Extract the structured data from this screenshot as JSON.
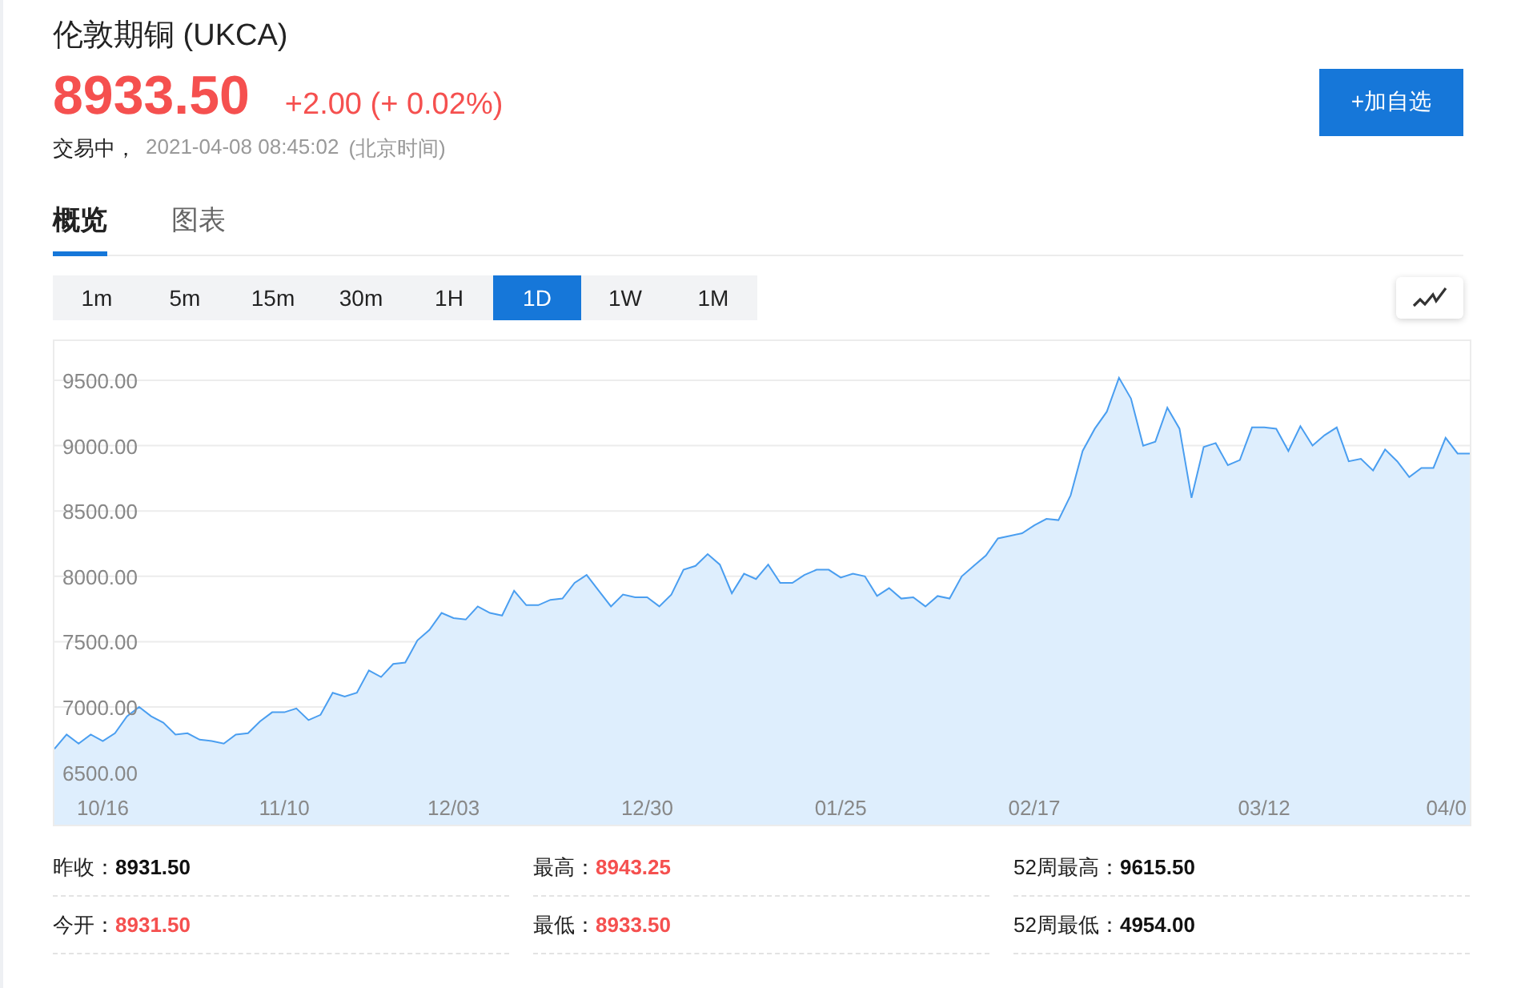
{
  "header": {
    "title": "伦敦期铜 (UKCA)",
    "price": "8933.50",
    "change": "+2.00 (+ 0.02%)",
    "status": "交易中，",
    "timestamp": "2021-04-08 08:45:02",
    "timezone": "(北京时间)",
    "watch_button": "+加自选"
  },
  "tabs": [
    {
      "label": "概览",
      "selected": true
    },
    {
      "label": "图表",
      "selected": false
    }
  ],
  "periods": [
    {
      "label": "1m",
      "selected": false
    },
    {
      "label": "5m",
      "selected": false
    },
    {
      "label": "15m",
      "selected": false
    },
    {
      "label": "30m",
      "selected": false
    },
    {
      "label": "1H",
      "selected": false
    },
    {
      "label": "1D",
      "selected": true
    },
    {
      "label": "1W",
      "selected": false
    },
    {
      "label": "1M",
      "selected": false
    }
  ],
  "chart": {
    "chart_data": {
      "type": "area",
      "ylim": [
        6100,
        9800
      ],
      "grid": true,
      "categories": [
        null,
        null,
        null,
        null,
        "10/16",
        null,
        null,
        null,
        null,
        null,
        null,
        null,
        null,
        null,
        null,
        null,
        null,
        null,
        null,
        "11/10",
        null,
        null,
        null,
        null,
        null,
        null,
        null,
        null,
        null,
        null,
        null,
        null,
        null,
        "12/03",
        null,
        null,
        null,
        null,
        null,
        null,
        null,
        null,
        null,
        null,
        null,
        null,
        null,
        null,
        null,
        "12/30",
        null,
        null,
        null,
        null,
        null,
        null,
        null,
        null,
        null,
        null,
        null,
        null,
        null,
        null,
        null,
        "01/25",
        null,
        null,
        null,
        null,
        null,
        null,
        null,
        null,
        null,
        null,
        null,
        null,
        null,
        null,
        null,
        "02/17",
        null,
        null,
        null,
        null,
        null,
        null,
        null,
        null,
        null,
        null,
        null,
        null,
        null,
        null,
        null,
        null,
        null,
        null,
        "03/12",
        null,
        null,
        null,
        null,
        null,
        null,
        null,
        null,
        null,
        null,
        null,
        null,
        null,
        null,
        null,
        "04/0",
        null
      ],
      "yticks": [
        {
          "value": 6500,
          "label": "6500.00"
        },
        {
          "value": 7000,
          "label": "7000.00"
        },
        {
          "value": 7500,
          "label": "7500.00"
        },
        {
          "value": 8000,
          "label": "8000.00"
        },
        {
          "value": 8500,
          "label": "8500.00"
        },
        {
          "value": 9000,
          "label": "9000.00"
        },
        {
          "value": 9500,
          "label": "9500.00"
        }
      ],
      "series": [
        {
          "color": "#4a9ef0",
          "values": [
            6680,
            6790,
            6720,
            6790,
            6740,
            6800,
            6930,
            7000,
            6930,
            6880,
            6790,
            6800,
            6750,
            6740,
            6720,
            6790,
            6800,
            6890,
            6960,
            6960,
            6990,
            6900,
            6940,
            7110,
            7080,
            7110,
            7280,
            7230,
            7330,
            7340,
            7510,
            7590,
            7720,
            7680,
            7670,
            7770,
            7720,
            7700,
            7890,
            7780,
            7780,
            7820,
            7830,
            7950,
            8010,
            7890,
            7770,
            7860,
            7840,
            7840,
            7770,
            7860,
            8050,
            8080,
            8170,
            8090,
            7870,
            8020,
            7980,
            8090,
            7950,
            7950,
            8010,
            8050,
            8050,
            7990,
            8020,
            8000,
            7850,
            7910,
            7830,
            7840,
            7770,
            7850,
            7830,
            8000,
            8080,
            8160,
            8290,
            8310,
            8330,
            8390,
            8440,
            8430,
            8620,
            8960,
            9130,
            9260,
            9520,
            9360,
            9000,
            9030,
            9290,
            9130,
            8600,
            8990,
            9020,
            8850,
            8890,
            9140,
            9140,
            9130,
            8960,
            9150,
            9000,
            9080,
            9140,
            8880,
            8900,
            8810,
            8970,
            8880,
            8760,
            8830,
            8830,
            9060,
            8940,
            8940
          ]
        }
      ]
    }
  },
  "stats": [
    [
      {
        "label": "昨收：",
        "value": "8931.50",
        "color": "#111111"
      },
      {
        "label": "今开：",
        "value": "8931.50",
        "color": "#f5504f"
      }
    ],
    [
      {
        "label": "最高：",
        "value": "8943.25",
        "color": "#f5504f"
      },
      {
        "label": "最低：",
        "value": "8933.50",
        "color": "#f5504f"
      }
    ],
    [
      {
        "label": "52周最高：",
        "value": "9615.50",
        "color": "#111111"
      },
      {
        "label": "52周最低：",
        "value": "4954.00",
        "color": "#111111"
      }
    ]
  ]
}
